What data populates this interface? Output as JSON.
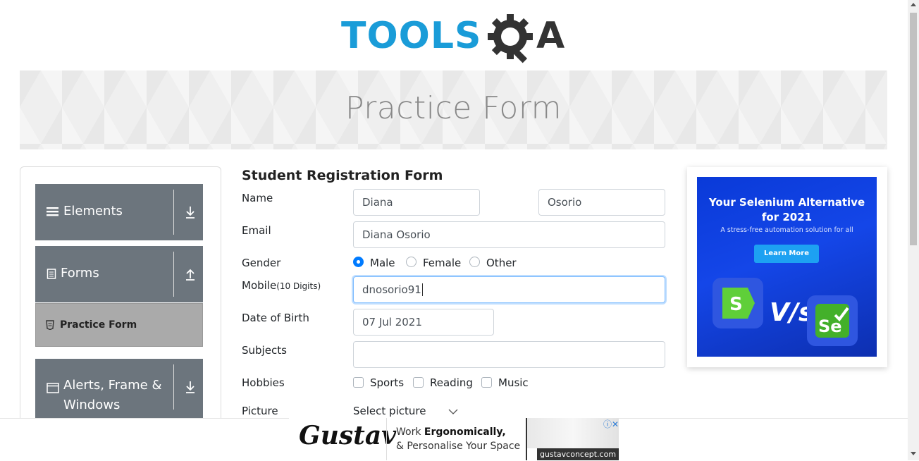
{
  "logo": {
    "text_left": "TOOLS",
    "text_right": "A"
  },
  "banner": {
    "title": "Practice Form"
  },
  "sidebar": {
    "groups": [
      {
        "label": "Elements"
      },
      {
        "label": "Forms"
      },
      {
        "label": "Alerts, Frame &",
        "label2": "Windows"
      }
    ],
    "active_item": "Practice Form"
  },
  "form": {
    "title": "Student Registration Form",
    "name_label": "Name",
    "first_name": "Diana",
    "last_name": "Osorio",
    "email_label": "Email",
    "email_value": "Diana Osorio",
    "gender_label": "Gender",
    "gender_options": [
      "Male",
      "Female",
      "Other"
    ],
    "gender_selected": "Male",
    "mobile_label": "Mobile",
    "mobile_hint": "(10 Digits)",
    "mobile_value": "dnosorio91",
    "dob_label": "Date of Birth",
    "dob_value": "07 Jul 2021",
    "subjects_label": "Subjects",
    "subjects_value": "",
    "hobbies_label": "Hobbies",
    "hobbies": [
      "Sports",
      "Reading",
      "Music"
    ],
    "picture_label": "Picture",
    "picture_button": "Select picture"
  },
  "side_ad": {
    "headline_1": "Your Selenium Alternative",
    "headline_2": "for 2021",
    "subtext": "A stress-free automation solution for all",
    "button": "Learn More",
    "vs": "V/s",
    "logo_left": "S",
    "logo_right": "Se"
  },
  "bottom_ad": {
    "brand": "Gustav",
    "line1_a": "Work ",
    "line1_b": "Ergonomically,",
    "line2": "& Personalise Your Space",
    "site": "gustavconcept.com",
    "close": "ⓘ✕"
  },
  "colors": {
    "accent": "#007bff",
    "logo_blue": "#1a9cd8",
    "logo_dark": "#333333",
    "sidebar_bg": "#6c757d"
  }
}
